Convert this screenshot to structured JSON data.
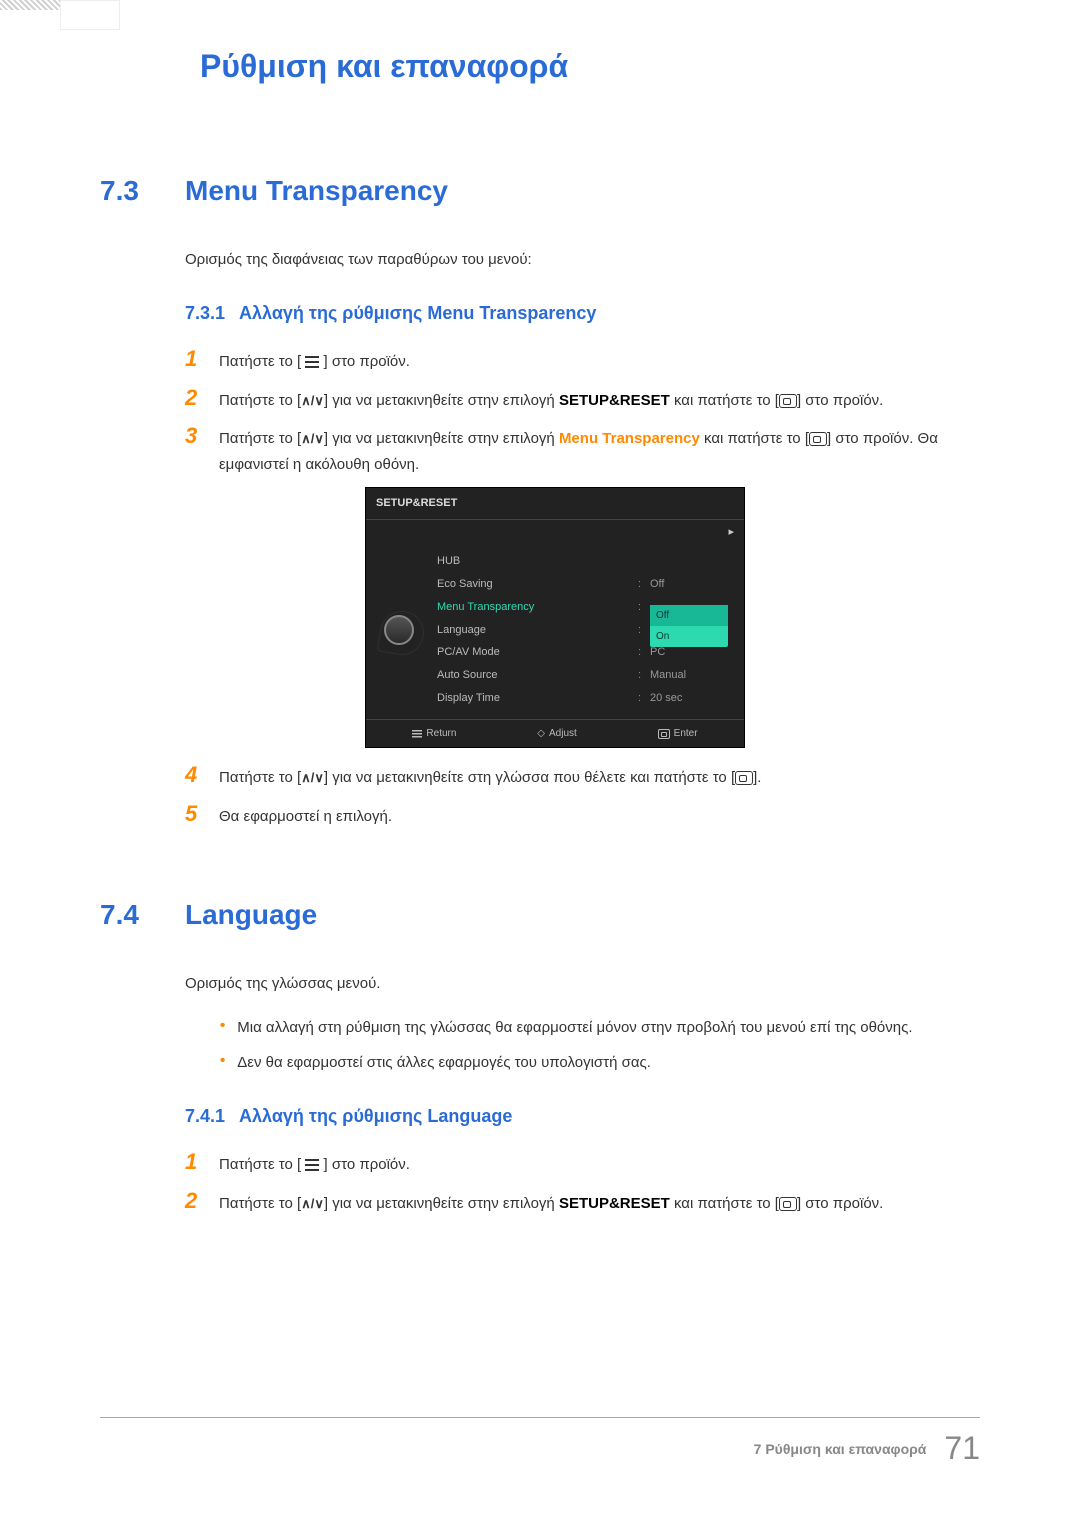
{
  "chapter_title": "Ρύθμιση και επαναφορά",
  "sections": {
    "s73": {
      "num": "7.3",
      "title": "Menu Transparency",
      "intro": "Ορισμός της διαφάνειας των παραθύρων του μενού:",
      "sub": {
        "num": "7.3.1",
        "title": "Αλλαγή της ρύθμισης Menu Transparency"
      },
      "steps": {
        "s1": {
          "n": "1",
          "t_a": "Πατήστε το [",
          "t_b": "] στο προϊόν."
        },
        "s2": {
          "n": "2",
          "t_a": "Πατήστε το [",
          "t_b": "] για να μετακινηθείτε στην επιλογή ",
          "kw": "SETUP&RESET",
          "t_c": " και πατήστε το [",
          "t_d": "] στο προϊόν."
        },
        "s3": {
          "n": "3",
          "t_a": "Πατήστε το [",
          "t_b": "] για να μετακινηθείτε στην επιλογή ",
          "kw": "Menu Transparency",
          "t_c": " και πατήστε το [",
          "t_d": "] στο προϊόν. Θα εμφανιστεί η ακόλουθη οθόνη."
        },
        "s4": {
          "n": "4",
          "t_a": "Πατήστε το [",
          "t_b": "] για να μετακινηθείτε στη γλώσσα που θέλετε και πατήστε το [",
          "t_c": "]."
        },
        "s5": {
          "n": "5",
          "t": "Θα εφαρμοστεί η επιλογή."
        }
      }
    },
    "s74": {
      "num": "7.4",
      "title": "Language",
      "intro": "Ορισμός της γλώσσας μενού.",
      "bullets": {
        "b1": "Μια αλλαγή στη ρύθμιση της γλώσσας θα εφαρμοστεί μόνον στην προβολή του μενού επί της οθόνης.",
        "b2": "Δεν θα εφαρμοστεί στις άλλες εφαρμογές του υπολογιστή σας."
      },
      "sub": {
        "num": "7.4.1",
        "title": "Αλλαγή της ρύθμισης Language"
      },
      "steps": {
        "s1": {
          "n": "1",
          "t_a": "Πατήστε το [",
          "t_b": "] στο προϊόν."
        },
        "s2": {
          "n": "2",
          "t_a": "Πατήστε το [",
          "t_b": "] για να μετακινηθείτε στην επιλογή ",
          "kw": "SETUP&RESET",
          "t_c": " και πατήστε το [",
          "t_d": "] στο προϊόν."
        }
      }
    }
  },
  "osd": {
    "title": "SETUP&RESET",
    "rows": {
      "hub": "HUB",
      "eco": "Eco Saving",
      "eco_v": "Off",
      "mt": "Menu Transparency",
      "lang": "Language",
      "pcav": "PC/AV Mode",
      "pcav_v": "PC",
      "auto": "Auto Source",
      "auto_v": "Manual",
      "disp": "Display Time",
      "disp_v": "20 sec"
    },
    "opts": {
      "off": "Off",
      "on": "On"
    },
    "footer": {
      "ret": "Return",
      "adj": "Adjust",
      "ent": "Enter"
    }
  },
  "footer": {
    "text": "7 Ρύθμιση και επαναφορά",
    "page": "71"
  }
}
